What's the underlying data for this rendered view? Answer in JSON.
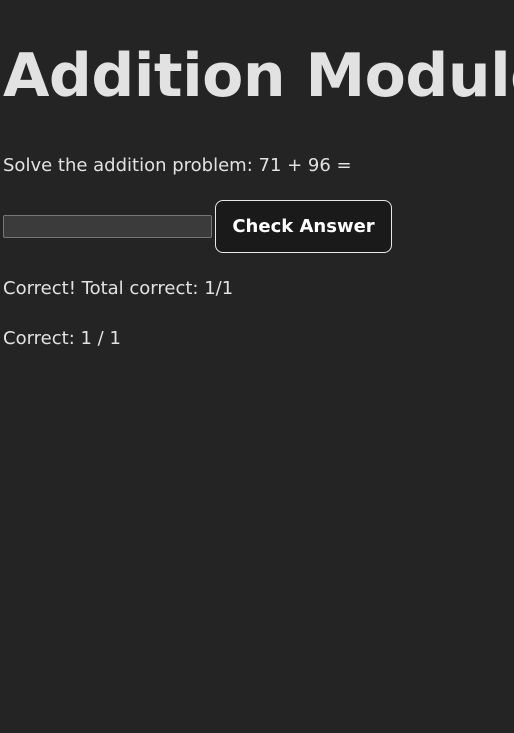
{
  "page": {
    "title": "Addition Module"
  },
  "problem": {
    "text": "Solve the addition problem: 71 + 96 ="
  },
  "answer": {
    "value": "",
    "placeholder": ""
  },
  "check_button": {
    "label": "Check Answer"
  },
  "feedback": {
    "text": "Correct! Total correct: 1/1"
  },
  "score": {
    "text": "Correct: 1 / 1"
  },
  "colors": {
    "background": "#242424",
    "text": "#dedede",
    "button_background": "#1a1a1a",
    "button_border": "#e8e8e8",
    "input_background": "#3b3b3b"
  }
}
